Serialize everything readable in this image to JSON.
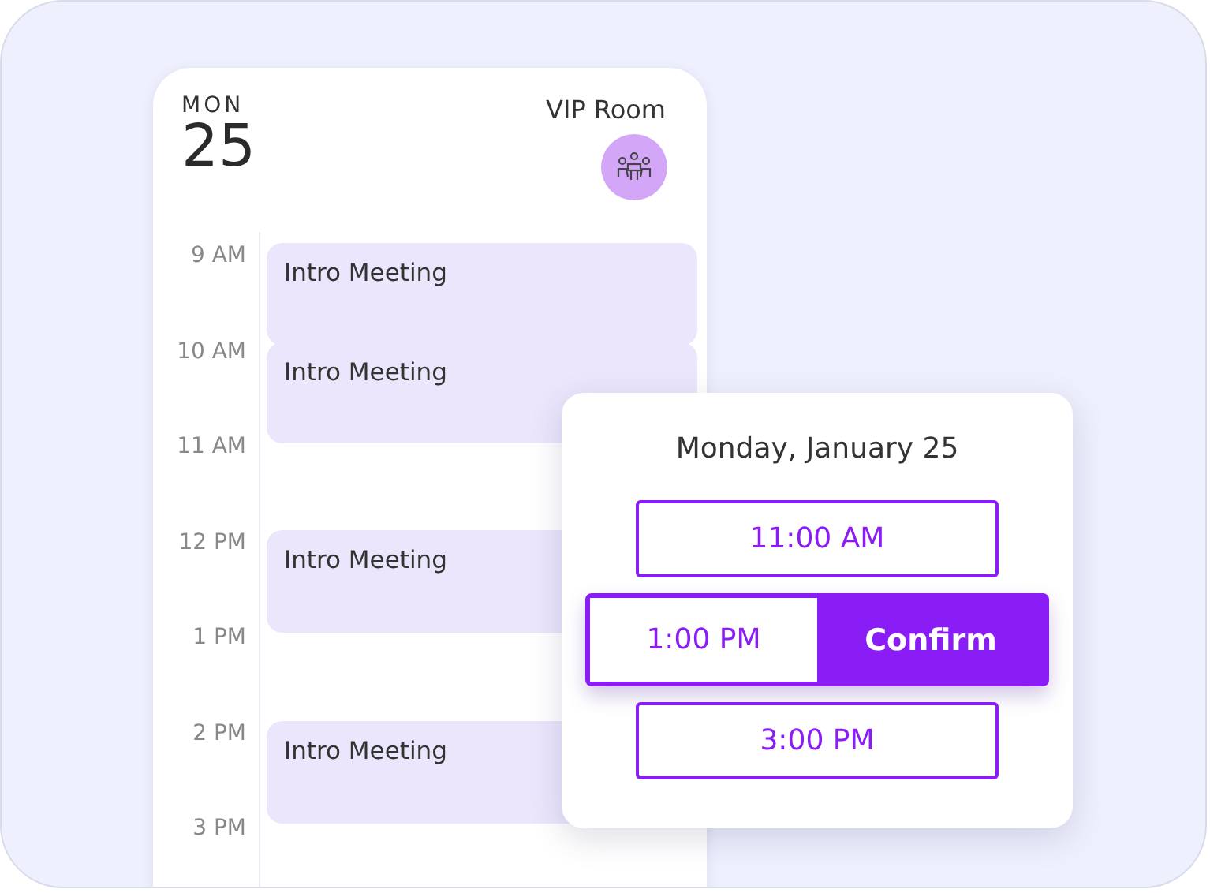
{
  "calendar": {
    "weekday": "MON",
    "day": "25",
    "room": "VIP Room",
    "hours": [
      {
        "label": "9 AM",
        "event": "Intro Meeting"
      },
      {
        "label": "10 AM",
        "event": "Intro Meeting"
      },
      {
        "label": "11 AM"
      },
      {
        "label": "12 PM",
        "event": "Intro Meeting"
      },
      {
        "label": "1 PM"
      },
      {
        "label": "2 PM",
        "event": "Intro Meeting"
      },
      {
        "label": "3 PM"
      }
    ]
  },
  "booking": {
    "title": "Monday, January 25",
    "confirm": "Confirm",
    "slots": [
      {
        "label": "11:00 AM",
        "selected": false
      },
      {
        "label": "1:00 PM",
        "selected": true
      },
      {
        "label": "3:00 PM",
        "selected": false
      }
    ]
  }
}
